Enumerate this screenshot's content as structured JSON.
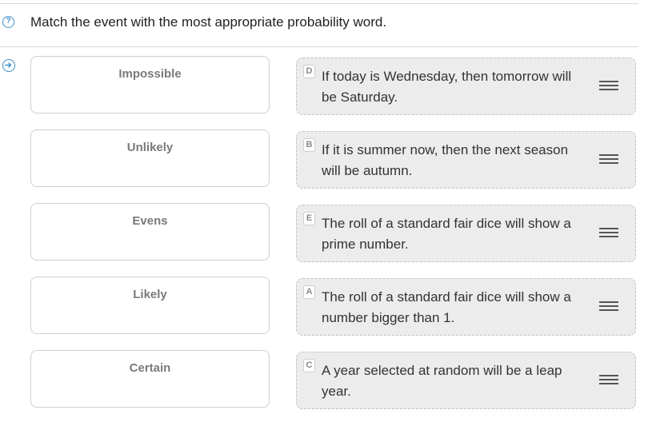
{
  "question": {
    "text": "Match the event with the most appropriate probability word.",
    "help_icon": "question-circle-icon",
    "answer_icon": "arrow-right-circle-icon"
  },
  "targets": [
    {
      "label": "Impossible"
    },
    {
      "label": "Unlikely"
    },
    {
      "label": "Evens"
    },
    {
      "label": "Likely"
    },
    {
      "label": "Certain"
    }
  ],
  "cards": [
    {
      "badge": "D",
      "text": "If today is Wednesday, then tomorrow will be Saturday."
    },
    {
      "badge": "B",
      "text": "If it is summer now, then the next season will be autumn."
    },
    {
      "badge": "E",
      "text": "The roll of a standard fair dice will show a prime number."
    },
    {
      "badge": "A",
      "text": "The roll of a standard fair dice will show a number bigger than 1."
    },
    {
      "badge": "C",
      "text": "A year selected at random will be a leap year."
    }
  ],
  "colors": {
    "accent": "#3a8fc8",
    "card_bg": "#ececec"
  }
}
